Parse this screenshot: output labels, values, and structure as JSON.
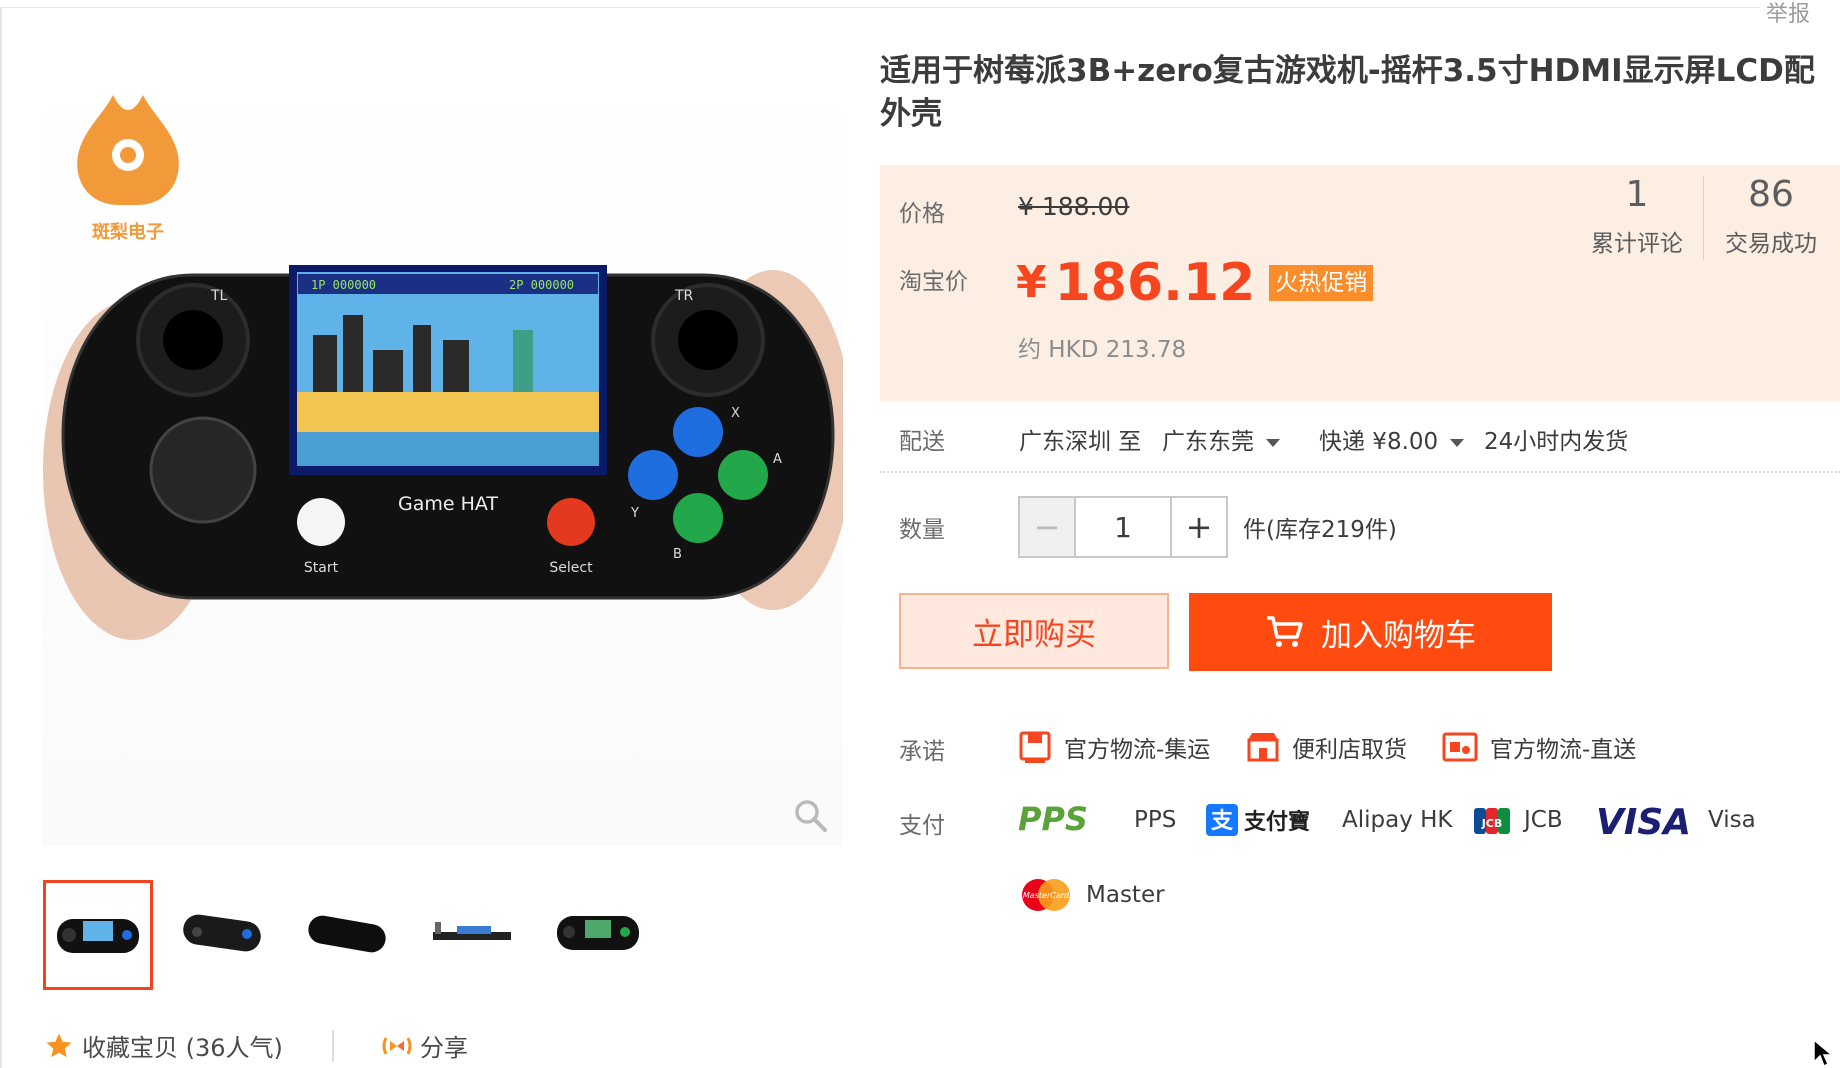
{
  "report": "举报",
  "title": "适用于树莓派3B+zero复古游戏机-摇杆3.5寸HDMI显示屏LCD配外壳",
  "brand_logo_text": "斑梨电子",
  "device": {
    "name": "Game HAT",
    "start": "Start",
    "select": "Select",
    "tl": "TL",
    "tr": "TR",
    "x": "X",
    "y": "Y",
    "a": "A",
    "b": "B",
    "p1": "1P 000000",
    "p2": "2P 000000"
  },
  "price": {
    "label": "价格",
    "original": "¥ 188.00",
    "taobao_label": "淘宝价",
    "currency": "¥",
    "amount": "186.12",
    "badge": "火热促销",
    "hkd": "约 HKD 213.78"
  },
  "stats": [
    {
      "num": "1",
      "caption": "累计评论"
    },
    {
      "num": "86",
      "caption": "交易成功"
    }
  ],
  "delivery": {
    "label": "配送",
    "from": "广东深圳 至",
    "to": "广东东莞",
    "express": "快递 ¥8.00",
    "ship": "24小时内发货"
  },
  "quantity": {
    "label": "数量",
    "minus": "−",
    "value": "1",
    "plus": "+",
    "stock": "件(库存219件)"
  },
  "buttons": {
    "buy_now": "立即购买",
    "add_cart": "加入购物车"
  },
  "promise": {
    "label": "承诺",
    "items": [
      "官方物流-集运",
      "便利店取货",
      "官方物流-直送"
    ]
  },
  "payment": {
    "label": "支付",
    "items": [
      "PPS",
      "Alipay HK",
      "JCB",
      "Visa",
      "Master"
    ],
    "logos": {
      "pps": "PPS",
      "alipay": "支付寶",
      "jcb": "JCB",
      "visa": "VISA",
      "mastercard": "MasterCard"
    }
  },
  "favorite": "收藏宝贝 (36人气)",
  "share": "分享",
  "colors": {
    "accent": "#f5461f",
    "price_bg": "#fdeee3",
    "badge": "#fb8e2b"
  }
}
